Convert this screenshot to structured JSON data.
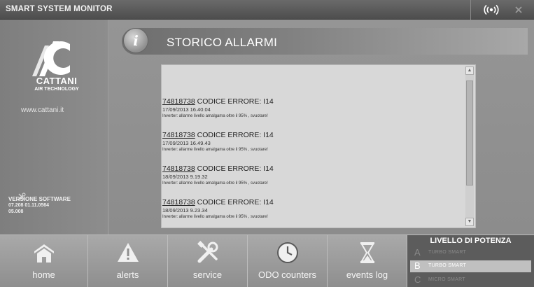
{
  "app": {
    "title": "SMART SYSTEM MONITOR"
  },
  "sidebar": {
    "brand_name": "CATTANI",
    "brand_sub": "AIR TECHNOLOGY",
    "website": "www.cattani.it",
    "version": {
      "title": "VERSIONE SOFTWARE",
      "line1": "07.208    01.11.0564",
      "line2": "05.008"
    }
  },
  "main": {
    "section_title": "STORICO ALLARMI",
    "info_glyph": "i",
    "alarms": [
      {
        "id": "74818738",
        "code": "CODICE ERRORE: I14",
        "date": "17/09/2013 16.40.04",
        "desc": "Inverter: allarme livello amalgama oltre il 95% , svuotare!"
      },
      {
        "id": "74818738",
        "code": "CODICE ERRORE: I14",
        "date": "17/09/2013 16.49.43",
        "desc": "Inverter: allarme livello amalgama oltre il 95% , svuotare!"
      },
      {
        "id": "74818738",
        "code": "CODICE ERRORE: I14",
        "date": "18/09/2013 9.19.32",
        "desc": "Inverter: allarme livello amalgama oltre il 95% , svuotare!"
      },
      {
        "id": "74818738",
        "code": "CODICE ERRORE: I14",
        "date": "18/09/2013 9.23.34",
        "desc": "Inverter: allarme livello amalgama oltre il 95% , svuotare!"
      }
    ]
  },
  "nav": [
    {
      "label": "home",
      "icon": "home-icon"
    },
    {
      "label": "alerts",
      "icon": "warning-icon"
    },
    {
      "label": "service",
      "icon": "tools-icon"
    },
    {
      "label": "ODO counters",
      "icon": "clock-icon"
    },
    {
      "label": "events log",
      "icon": "hourglass-icon"
    }
  ],
  "power": {
    "title": "LIVELLO DI POTENZA",
    "levels": [
      {
        "letter": "A",
        "label": "TURBO SMART",
        "active": false
      },
      {
        "letter": "B",
        "label": "TURBO SMART",
        "active": true
      },
      {
        "letter": "C",
        "label": "MICRO SMART",
        "active": false
      }
    ]
  },
  "colors": {
    "frame": "#8a8a8a",
    "titlebar": "#555555",
    "panel": "#d8d8d8",
    "power_panel": "#5c5c5c"
  }
}
